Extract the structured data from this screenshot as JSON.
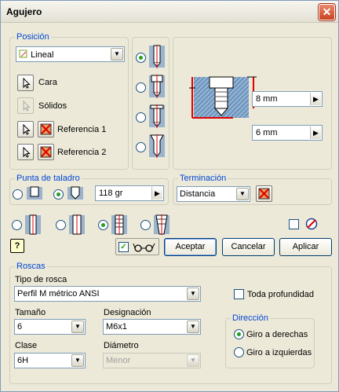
{
  "window": {
    "title": "Agujero",
    "close_icon": "close-icon"
  },
  "posicion": {
    "label": "Posición",
    "mode_value": "Lineal",
    "cara_label": "Cara",
    "solidos_label": "Sólidos",
    "ref1_label": "Referencia 1",
    "ref2_label": "Referencia 2"
  },
  "hole_types": {
    "selected_index": 0
  },
  "preview": {
    "depth_value": "8 mm",
    "diameter_value": "6 mm"
  },
  "punta": {
    "label": "Punta de taladro",
    "angle_value": "118 gr"
  },
  "terminacion": {
    "label": "Terminación",
    "value": "Distancia"
  },
  "buttons": {
    "accept": "Aceptar",
    "cancel": "Cancelar",
    "apply": "Aplicar"
  },
  "roscas": {
    "label": "Roscas",
    "tipo_label": "Tipo de rosca",
    "tipo_value": "Perfil M métrico ANSI",
    "toda_label": "Toda profundidad",
    "tamano_label": "Tamaño",
    "tamano_value": "6",
    "designacion_label": "Designación",
    "designacion_value": "M6x1",
    "clase_label": "Clase",
    "clase_value": "6H",
    "diametro_label": "Diámetro",
    "diametro_value": "Menor",
    "direccion_label": "Dirección",
    "derecha_label": "Giro a derechas",
    "izquierda_label": "Giro a izquierdas"
  },
  "colors": {
    "accent": "#0046d5",
    "red": "#e00000"
  }
}
